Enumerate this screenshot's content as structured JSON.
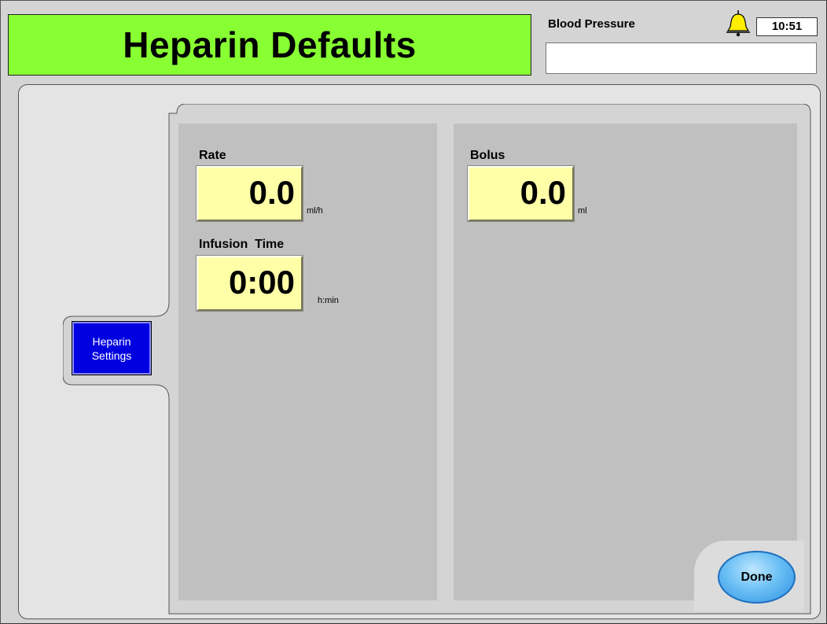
{
  "header": {
    "title": "Heparin Defaults",
    "bp_label": "Blood Pressure",
    "bp_value": "",
    "time": "10:51",
    "alarm_icon": "bell-icon",
    "title_color": "#88ff33"
  },
  "sidebar": {
    "tab_line1": "Heparin",
    "tab_line2": "Settings",
    "tab_color": "#0000e0"
  },
  "fields": {
    "rate": {
      "label": "Rate",
      "value": "0.0",
      "unit": "ml/h"
    },
    "infusion_time": {
      "label": "Infusion  Time",
      "value": "0:00",
      "unit": "h:min"
    },
    "bolus": {
      "label": "Bolus",
      "value": "0.0",
      "unit": "ml"
    }
  },
  "footer": {
    "done_label": "Done"
  }
}
